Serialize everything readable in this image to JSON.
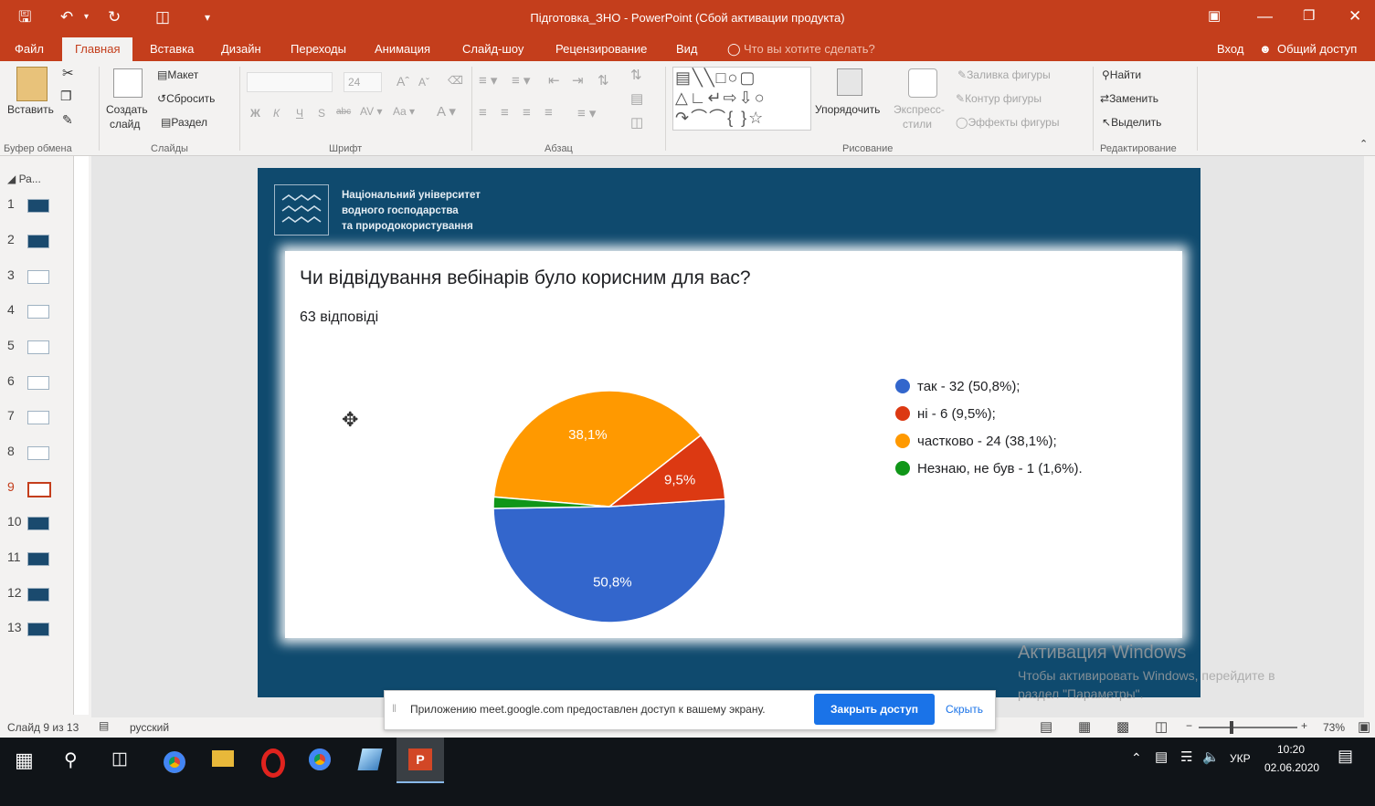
{
  "window": {
    "title": "Підготовка_ЗНО - PowerPoint (Сбой активации продукта)"
  },
  "tabs": [
    "Файл",
    "Главная",
    "Вставка",
    "Дизайн",
    "Переходы",
    "Анимация",
    "Слайд-шоу",
    "Рецензирование",
    "Вид"
  ],
  "tell_me": "Что вы хотите сделать?",
  "signin": "Вход",
  "share": "Общий доступ",
  "ribbon": {
    "clipboard": {
      "paste": "Вставить",
      "group": "Буфер обмена"
    },
    "slides": {
      "layout": "Макет",
      "reset": "Сбросить",
      "new_slide": "Создать",
      "new_slide2": "слайд",
      "section": "Раздел",
      "group": "Слайды"
    },
    "font": {
      "size": "24",
      "bold": "Ж",
      "italic": "К",
      "underline": "Ч",
      "strike": "S",
      "spacing": "abc",
      "group": "Шрифт"
    },
    "paragraph": {
      "group": "Абзац"
    },
    "drawing": {
      "arrange": "Упорядочить",
      "styles": "Экспресс-",
      "styles2": "стили",
      "fill": "Заливка фигуры",
      "outline": "Контур фигуры",
      "effects": "Эффекты фигуры",
      "group": "Рисование"
    },
    "editing": {
      "find": "Найти",
      "replace": "Заменить",
      "select": "Выделить",
      "group": "Редактирование"
    }
  },
  "thumbnails": {
    "header": "Ра...",
    "items": [
      "1",
      "2",
      "3",
      "4",
      "5",
      "6",
      "7",
      "8",
      "9",
      "10",
      "11",
      "12",
      "13"
    ],
    "selected": "9"
  },
  "slide": {
    "org_line1": "Національний університет",
    "org_line2": "водного господарства",
    "org_line3": "та природокористування",
    "question": "Чи відвідування вебінарів було корисним для вас?",
    "responses": "63 відповіді"
  },
  "chart_data": {
    "type": "pie",
    "categories": [
      "так",
      "ні",
      "частково",
      "Незнаю, не був"
    ],
    "values": [
      32,
      6,
      24,
      1
    ],
    "percent_labels": [
      "50,8%",
      "9,5%",
      "38,1%",
      ""
    ],
    "colors": [
      "#3366cc",
      "#dc3912",
      "#ff9900",
      "#109618"
    ],
    "legend": [
      "так - 32 (50,8%);",
      "ні - 6 (9,5%);",
      "частково - 24 (38,1%);",
      "Незнаю, не був - 1 (1,6%)."
    ],
    "legend_position": "right"
  },
  "watermark": {
    "line1": "Активация Windows",
    "line2": "Чтобы активировать Windows, перейдите в",
    "line3": "раздел \"Параметры\"."
  },
  "share_banner": {
    "text": "Приложению meet.google.com предоставлен доступ к вашему экрану.",
    "stop": "Закрыть доступ",
    "hide": "Скрыть"
  },
  "status": {
    "slide": "Слайд 9 из 13",
    "lang": "русский",
    "zoom": "73%"
  },
  "taskbar": {
    "lang": "УКР",
    "time": "10:20",
    "date": "02.06.2020"
  }
}
